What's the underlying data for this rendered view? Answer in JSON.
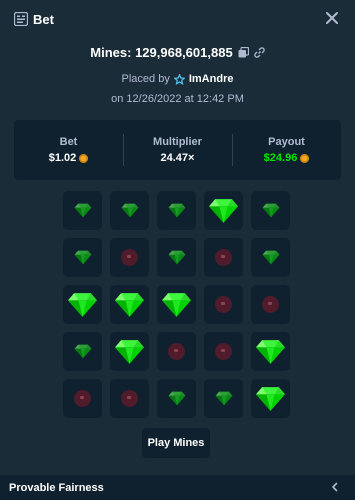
{
  "header": {
    "title": "Bet",
    "icon": "bet-slip-icon",
    "close_icon": "close-icon"
  },
  "bet_id_label": "Mines: 129,968,601,885",
  "placed_by": {
    "prefix": "Placed by",
    "username": "ImAndre",
    "badge_icon": "vip-star-icon"
  },
  "date_text": "on 12/26/2022 at 12:42 PM",
  "stats": {
    "bet": {
      "label": "Bet",
      "value": "$1.02",
      "currency_icon": "coin-icon"
    },
    "multiplier": {
      "label": "Multiplier",
      "value": "24.47×"
    },
    "payout": {
      "label": "Payout",
      "value": "$24.96",
      "currency_icon": "coin-icon",
      "color": "#00e701"
    }
  },
  "grid": {
    "rows": 5,
    "cols": 5,
    "tiles": [
      "gem",
      "gem",
      "gem",
      "gem-revealed",
      "gem",
      "gem",
      "mine",
      "gem",
      "mine",
      "gem",
      "gem-revealed",
      "gem-revealed",
      "gem-revealed",
      "mine",
      "mine",
      "gem",
      "gem-revealed",
      "mine",
      "mine",
      "gem-revealed",
      "mine",
      "mine",
      "gem",
      "gem",
      "gem-revealed"
    ]
  },
  "play_button_label": "Play Mines",
  "footer": {
    "label": "Provable Fairness",
    "chevron_icon": "chevron-left-icon"
  },
  "colors": {
    "background": "#1a2c38",
    "panel": "#0f212e",
    "accent_green": "#00e701",
    "muted_text": "#b1bad3",
    "mine_red": "#5c1a2b"
  }
}
